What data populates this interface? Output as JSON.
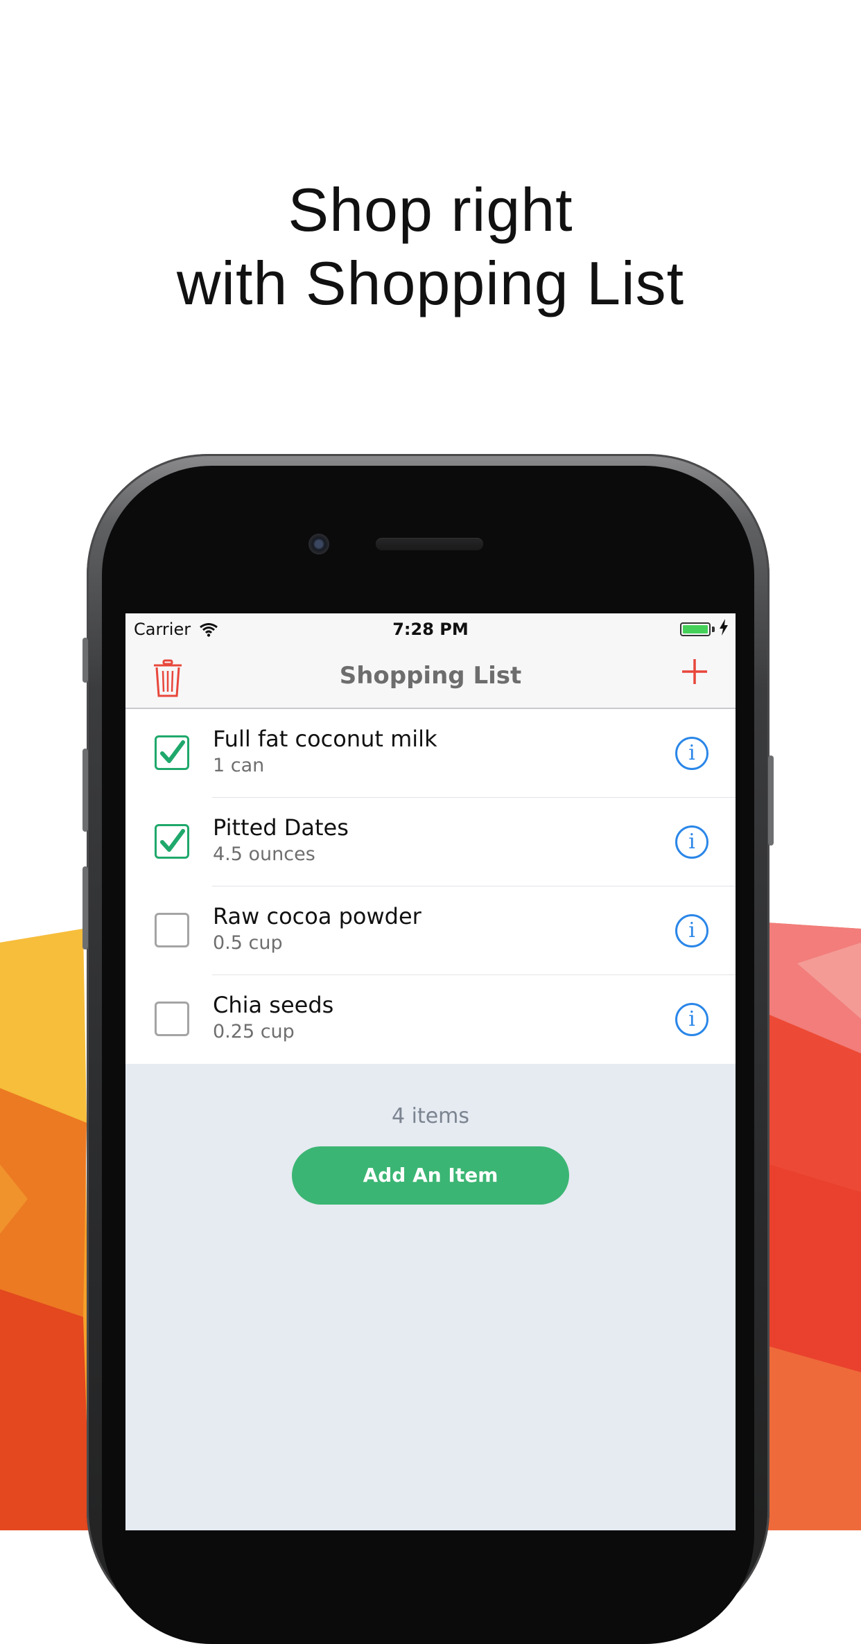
{
  "headline": {
    "line1": "Shop right",
    "line2": "with Shopping List"
  },
  "status_bar": {
    "carrier": "Carrier",
    "time": "7:28 PM",
    "wifi_icon": "wifi-icon",
    "battery_icon": "battery-icon",
    "charging_icon": "charging-bolt-icon"
  },
  "nav": {
    "title": "Shopping List",
    "left_icon": "trash-icon",
    "right_icon": "plus-icon"
  },
  "items": [
    {
      "name": "Full fat coconut milk",
      "quantity": "1 can",
      "checked": true
    },
    {
      "name": "Pitted Dates",
      "quantity": "4.5 ounces",
      "checked": true
    },
    {
      "name": "Raw cocoa powder",
      "quantity": "0.5 cup",
      "checked": false
    },
    {
      "name": "Chia seeds",
      "quantity": "0.25 cup",
      "checked": false
    }
  ],
  "info_icon": "info-icon",
  "info_glyph": "i",
  "footer": {
    "count_text": "4 items",
    "add_button_label": "Add An Item"
  },
  "colors": {
    "accent_green": "#3bb573",
    "check_green": "#1fa86b",
    "info_blue": "#2a86e8",
    "nav_red": "#e8473b",
    "list_background": "#e6eaf1"
  }
}
